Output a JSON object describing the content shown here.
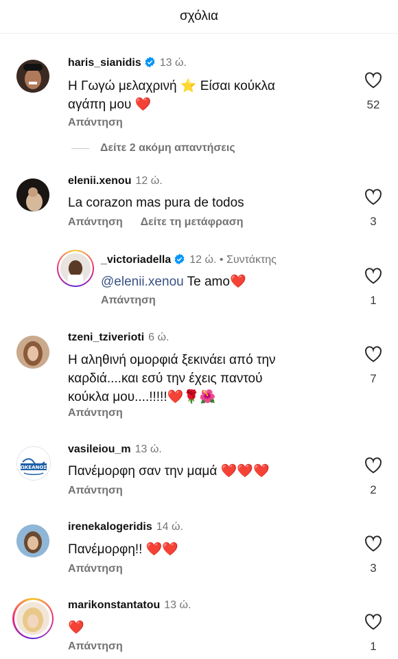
{
  "header": {
    "title": "σχόλια"
  },
  "ui": {
    "reply_label": "Απάντηση",
    "translate_label": "Δείτε τη μετάφραση",
    "more_replies": "Δείτε 2 ακόμη απαντήσεις"
  },
  "comments": [
    {
      "user": "haris_sianidis",
      "verified": true,
      "time": "13 ώ.",
      "text_line1": "Η Γωγώ μελαχρινή ⭐ Είσαι κούκλα",
      "text_line2": "αγάπη μου ❤️",
      "likes": "52"
    },
    {
      "user": "elenii.xenou",
      "verified": false,
      "time": "12 ώ.",
      "text_line1": "La corazon mas pura de todos",
      "likes": "3"
    },
    {
      "user": "_victoriadella",
      "verified": true,
      "time": "12 ώ. • Συντάκτης",
      "mention": "@elenii.xenou",
      "text_after": " Te amo❤️",
      "likes": "1"
    },
    {
      "user": "tzeni_tziverioti",
      "verified": false,
      "time": "6 ώ.",
      "text_line1": "Η αληθινή ομορφιά ξεκινάει από την",
      "text_line2": "καρδιά....και εσύ την έχεις παντού",
      "text_line3": "κούκλα μου....!!!!!❤️🌹🌺",
      "likes": "7"
    },
    {
      "user": "vasileiou_m",
      "verified": false,
      "time": "13 ώ.",
      "text_line1": "Πανέμορφη σαν την μαμά ❤️❤️❤️",
      "likes": "2",
      "avatar_text": "ΩΚΕΑΝΟΣ"
    },
    {
      "user": "irenekalogeridis",
      "verified": false,
      "time": "14 ώ.",
      "text_line1": "Πανέμορφη!! ❤️❤️",
      "likes": "3"
    },
    {
      "user": "marikonstantatou",
      "verified": false,
      "time": "13 ώ.",
      "text_line1": "❤️",
      "likes": "1"
    }
  ],
  "colors": {
    "verified": "#0095f6",
    "muted": "#737373",
    "mention": "#385185"
  }
}
